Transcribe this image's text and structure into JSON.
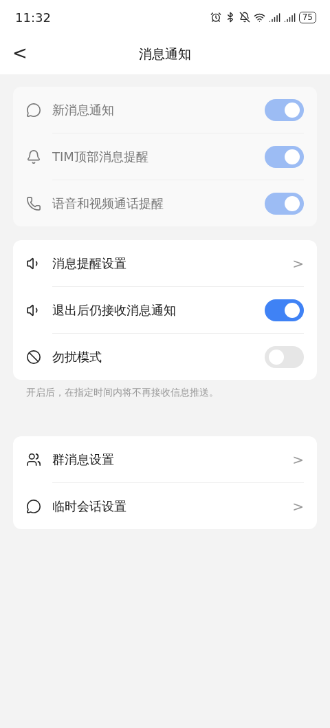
{
  "status_bar": {
    "time": "11:32",
    "battery": "75"
  },
  "header": {
    "back": "<",
    "title": "消息通知"
  },
  "groups": [
    {
      "rows": [
        {
          "kind": "toggle",
          "label": "新消息通知",
          "on": true,
          "disabled": true
        },
        {
          "kind": "toggle",
          "label": "TIM顶部消息提醒",
          "on": true,
          "disabled": true
        },
        {
          "kind": "toggle",
          "label": "语音和视频通话提醒",
          "on": true,
          "disabled": true
        }
      ]
    },
    {
      "rows": [
        {
          "kind": "link",
          "label": "消息提醒设置",
          "arrow": ">"
        },
        {
          "kind": "toggle",
          "label": "退出后仍接收消息通知",
          "on": true,
          "disabled": false
        },
        {
          "kind": "toggle",
          "label": "勿扰模式",
          "on": false,
          "disabled": false
        }
      ],
      "footnote": "开启后，在指定时间内将不再接收信息推送。"
    },
    {
      "rows": [
        {
          "kind": "link",
          "label": "群消息设置",
          "arrow": ">"
        },
        {
          "kind": "link",
          "label": "临时会话设置",
          "arrow": ">"
        }
      ]
    }
  ]
}
